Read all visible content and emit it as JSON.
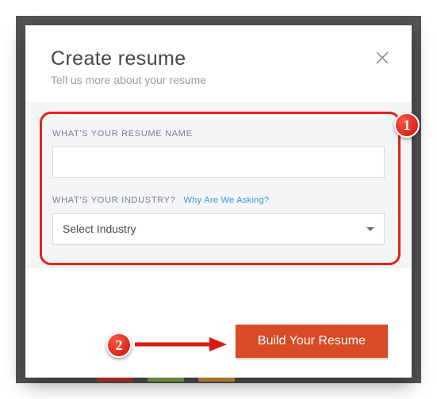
{
  "header": {
    "title": "Create resume",
    "subtitle": "Tell us more about your resume"
  },
  "form": {
    "name_label": "WHAT'S YOUR RESUME NAME",
    "name_value": "",
    "industry_label": "WHAT'S YOUR INDUSTRY?",
    "industry_helper": "Why Are We Asking?",
    "industry_selected": "Select Industry"
  },
  "footer": {
    "build_label": "Build Your Resume"
  },
  "annotations": {
    "step1": "1",
    "step2": "2"
  }
}
